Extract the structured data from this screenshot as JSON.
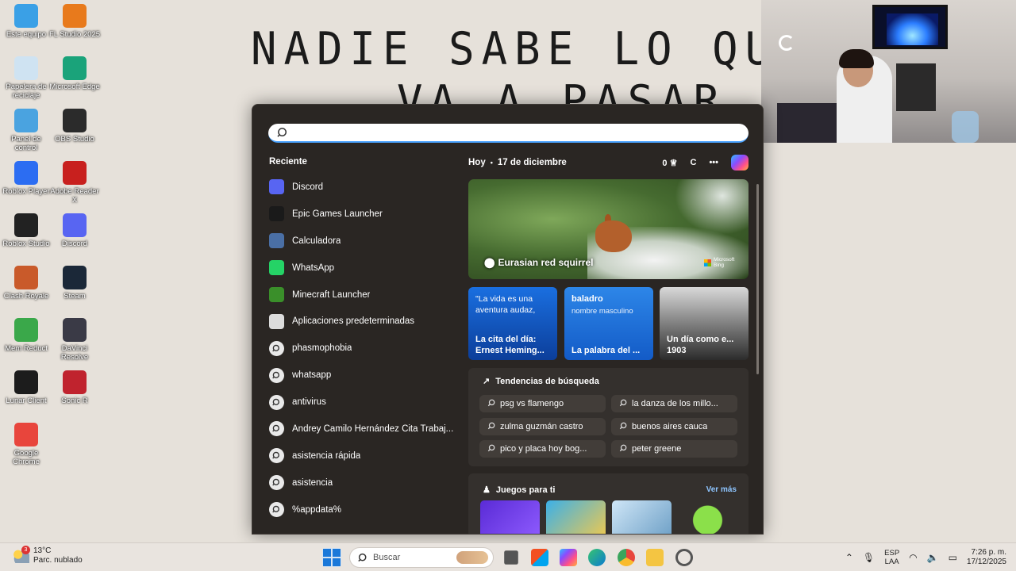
{
  "desktop": {
    "handwriting_line1": "NADIE SABE LO QUE",
    "handwriting_line2": "VA A PASAR",
    "icons": [
      {
        "label": "Este equipo",
        "icon": "monitor-icon",
        "color": "#3aa0e6"
      },
      {
        "label": "FL Studio 2025",
        "icon": "fl-studio-icon",
        "color": "#e87a1c"
      },
      {
        "label": "Papelera de reciclaje",
        "icon": "recycle-bin-icon",
        "color": "#cfe3f2"
      },
      {
        "label": "Microsoft Edge",
        "icon": "edge-icon",
        "color": "#1aa37a"
      },
      {
        "label": "Panel de control",
        "icon": "control-panel-icon",
        "color": "#4aa3e0"
      },
      {
        "label": "OBS Studio",
        "icon": "obs-icon",
        "color": "#2b2b2b"
      },
      {
        "label": "Roblox Player",
        "icon": "roblox-icon",
        "color": "#2c6df2"
      },
      {
        "label": "Adobe Reader X",
        "icon": "adobe-reader-icon",
        "color": "#c8201e"
      },
      {
        "label": "Roblox Studio",
        "icon": "roblox-studio-icon",
        "color": "#222222"
      },
      {
        "label": "Discord",
        "icon": "discord-icon",
        "color": "#5865f2"
      },
      {
        "label": "Clash Royale",
        "icon": "clash-royale-icon",
        "color": "#c95a2a"
      },
      {
        "label": "Steam",
        "icon": "steam-icon",
        "color": "#1b2838"
      },
      {
        "label": "Mem Reduct",
        "icon": "mem-reduct-icon",
        "color": "#3aa84a"
      },
      {
        "label": "DaVinci Resolve",
        "icon": "davinci-icon",
        "color": "#3a3a46"
      },
      {
        "label": "Lunar Client",
        "icon": "lunar-client-icon",
        "color": "#1c1c1c"
      },
      {
        "label": "Sonic R",
        "icon": "sonic-r-icon",
        "color": "#c0232e"
      },
      {
        "label": "Google Chrome",
        "icon": "chrome-icon",
        "color": "#e8453c"
      }
    ]
  },
  "start_menu": {
    "search_placeholder": "",
    "recent_title": "Reciente",
    "recent": [
      {
        "label": "Discord",
        "icon": "discord-icon",
        "color": "#5865f2"
      },
      {
        "label": "Epic Games Launcher",
        "icon": "epic-games-icon",
        "color": "#1a1a1a"
      },
      {
        "label": "Calculadora",
        "icon": "calculator-icon",
        "color": "#4a6fa5"
      },
      {
        "label": "WhatsApp",
        "icon": "whatsapp-icon",
        "color": "#25d366"
      },
      {
        "label": "Minecraft Launcher",
        "icon": "minecraft-icon",
        "color": "#3a8f2a"
      },
      {
        "label": "Aplicaciones predeterminadas",
        "icon": "default-apps-icon",
        "color": "#dcdcdc"
      },
      {
        "label": "phasmophobia",
        "icon": "search-icon",
        "color": "#e9e9e9"
      },
      {
        "label": "whatsapp",
        "icon": "search-icon",
        "color": "#e9e9e9"
      },
      {
        "label": "antivirus",
        "icon": "search-icon",
        "color": "#e9e9e9"
      },
      {
        "label": "Andrey Camilo Hernández Cita Trabaj...",
        "icon": "search-icon",
        "color": "#e9e9e9"
      },
      {
        "label": "asistencia rápida",
        "icon": "search-icon",
        "color": "#e9e9e9"
      },
      {
        "label": "asistencia",
        "icon": "search-icon",
        "color": "#e9e9e9"
      },
      {
        "label": "%appdata%",
        "icon": "search-icon",
        "color": "#e9e9e9"
      }
    ],
    "header": {
      "today": "Hoy",
      "date": "17 de diciembre",
      "points": "0",
      "profile_letter": "C"
    },
    "hero": {
      "caption": "Eurasian red squirrel",
      "brand": "Microsoft Bing"
    },
    "cards": [
      {
        "top": "\"La vida es una aventura audaz,",
        "sub": "",
        "foot": "La cita del día: Ernest Heming..."
      },
      {
        "top": "baladro",
        "sub": "nombre masculino",
        "foot": "La palabra del ..."
      },
      {
        "top": "",
        "sub": "",
        "foot": "Un día como e... 1903"
      }
    ],
    "trends": {
      "title": "Tendencias de búsqueda",
      "items": [
        "psg vs flamengo",
        "la danza de los millo...",
        "zulma guzmán castro",
        "buenos aires cauca",
        "pico y placa hoy bog...",
        "peter greene"
      ]
    },
    "games": {
      "title": "Juegos para ti",
      "see_more": "Ver más"
    }
  },
  "taskbar": {
    "weather_temp": "13°C",
    "weather_desc": "Parc. nublado",
    "weather_badge": "3",
    "search_label": "Buscar",
    "lang_top": "ESP",
    "lang_bottom": "LAA",
    "time": "7:26 p. m.",
    "date": "17/12/2025"
  }
}
